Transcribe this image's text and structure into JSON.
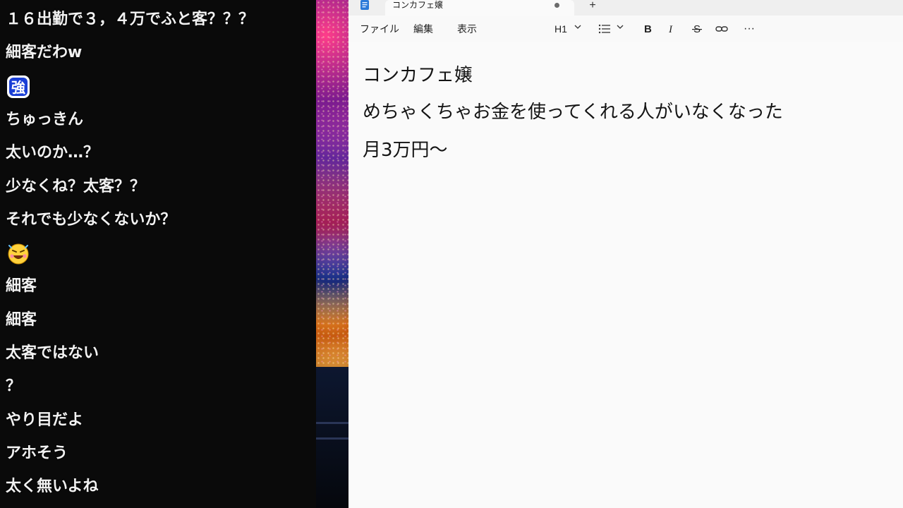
{
  "chat": {
    "lines": [
      {
        "type": "text",
        "text": "１６出勤で３，４万でふと客？？？"
      },
      {
        "type": "text",
        "text": "細客だわw"
      },
      {
        "type": "stamp",
        "text": "強",
        "stamp": "kanji-stamp"
      },
      {
        "type": "text",
        "text": "ちゅっきん"
      },
      {
        "type": "text",
        "text": "太いのか…？"
      },
      {
        "type": "text",
        "text": "少なくね？太客？？"
      },
      {
        "type": "text",
        "text": "それでも少なくないか？"
      },
      {
        "type": "stamp",
        "stamp": "smiling-face-emoji"
      },
      {
        "type": "text",
        "text": "細客"
      },
      {
        "type": "text",
        "text": "細客"
      },
      {
        "type": "text",
        "text": "太客ではない"
      },
      {
        "type": "text",
        "text": "？"
      },
      {
        "type": "text",
        "text": "やり目だよ"
      },
      {
        "type": "text",
        "text": "アホそう"
      },
      {
        "type": "text",
        "text": "太く無いよね"
      }
    ]
  },
  "notepad": {
    "tab_title": "コンカフェ嬢",
    "new_tab_label": "+",
    "menu": {
      "file": "ファイル",
      "edit": "編集",
      "view": "表示"
    },
    "toolbar": {
      "heading": "H1",
      "more": "···"
    },
    "content": [
      "コンカフェ嬢",
      "めちゃくちゃお金を使ってくれる人がいなくなった",
      "月3万円〜"
    ]
  },
  "colors": {
    "chat_bg": "#0a0a0a",
    "chat_text": "#f2f2f2",
    "notepad_bg": "#fafafa",
    "stamp_blue": "#1a3fd6"
  }
}
